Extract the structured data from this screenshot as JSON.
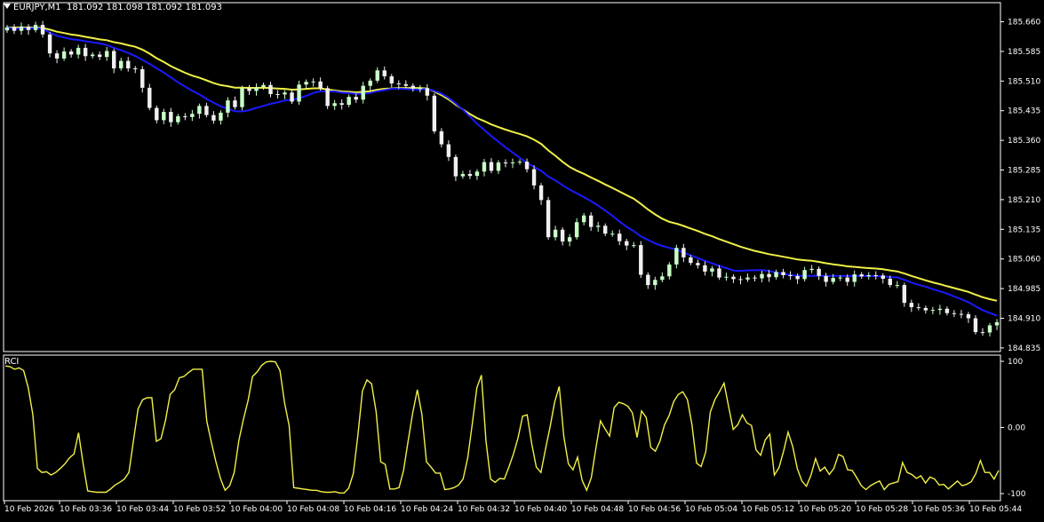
{
  "header": {
    "symbol": "EURJPY,M1",
    "ohlc": "181.092 181.098 181.092 181.093"
  },
  "indicator": {
    "label": "RCI"
  },
  "colors": {
    "background": "#000000",
    "grid": "#ffffff",
    "bull": "#c8ffc8",
    "bear": "#f0f0f0",
    "ma_fast": "#1a1aff",
    "ma_slow": "#f0f048",
    "rci": "#f0f048"
  },
  "chart_data": [
    {
      "type": "candlestick",
      "title": "EURJPY,M1",
      "y_ticks": [
        "185.660",
        "185.585",
        "185.510",
        "185.435",
        "185.360",
        "185.285",
        "185.210",
        "185.135",
        "185.060",
        "184.985",
        "184.910",
        "184.835"
      ],
      "ylim": [
        184.835,
        185.695
      ],
      "x_ticks": [
        "10 Feb 2026",
        "10 Feb 03:36",
        "10 Feb 03:44",
        "10 Feb 03:52",
        "10 Feb 04:00",
        "10 Feb 04:08",
        "10 Feb 04:16",
        "10 Feb 04:24",
        "10 Feb 04:32",
        "10 Feb 04:40",
        "10 Feb 04:48",
        "10 Feb 04:56",
        "10 Feb 05:04",
        "10 Feb 05:12",
        "10 Feb 05:20",
        "10 Feb 05:28",
        "10 Feb 05:36",
        "10 Feb 05:44"
      ],
      "close": [
        185.646,
        185.637,
        185.648,
        185.639,
        185.652,
        185.628,
        185.58,
        185.567,
        185.585,
        185.577,
        185.594,
        185.573,
        185.577,
        185.571,
        185.586,
        185.542,
        185.561,
        185.542,
        185.54,
        185.493,
        185.442,
        185.411,
        185.432,
        185.406,
        185.421,
        185.419,
        185.427,
        185.447,
        185.424,
        185.41,
        185.43,
        185.461,
        185.444,
        185.492,
        185.485,
        185.494,
        185.5,
        185.477,
        185.476,
        185.481,
        185.458,
        185.501,
        185.508,
        185.509,
        185.492,
        185.447,
        185.454,
        185.45,
        185.47,
        185.463,
        185.498,
        185.511,
        185.537,
        185.522,
        185.504,
        185.502,
        185.498,
        185.491,
        185.492,
        185.473,
        185.383,
        185.35,
        185.318,
        185.269,
        185.275,
        185.27,
        185.281,
        185.305,
        185.283,
        185.304,
        185.302,
        185.304,
        185.306,
        185.287,
        185.246,
        185.209,
        185.115,
        185.134,
        185.104,
        185.115,
        185.153,
        185.17,
        185.141,
        185.144,
        185.124,
        185.124,
        185.105,
        185.094,
        185.095,
        185.02,
        184.994,
        185.007,
        185.016,
        185.046,
        185.088,
        185.064,
        185.05,
        185.044,
        185.028,
        185.036,
        185.013,
        185.015,
        185.009,
        185.008,
        185.013,
        185.011,
        185.022,
        185.014,
        185.027,
        185.019,
        185.017,
        185.009,
        185.032,
        185.035,
        185.017,
        185.002,
        185.012,
        185.013,
        185.002,
        185.021,
        185.016,
        185.019,
        185.018,
        185.01,
        184.994,
        184.994,
        184.949,
        184.938,
        184.936,
        184.93,
        184.931,
        184.934,
        184.923,
        184.921,
        184.92,
        184.91,
        184.875,
        184.874,
        184.892,
        184.9
      ]
    },
    {
      "type": "line",
      "title": "RCI",
      "y_ticks": [
        "100",
        "0.00",
        "-100"
      ],
      "ylim": [
        -100,
        100
      ],
      "values": [
        93,
        92,
        88,
        90,
        86,
        60,
        20,
        -62,
        -68,
        -67,
        -72,
        -68,
        -62,
        -55,
        -46,
        -40,
        -8,
        -55,
        -96,
        -97,
        -98,
        -98,
        -98,
        -93,
        -87,
        -83,
        -78,
        -68,
        -19,
        28,
        42,
        45,
        45,
        -21,
        -17,
        11,
        50,
        57,
        75,
        77,
        83,
        88,
        88,
        88,
        10,
        -22,
        -52,
        -77,
        -95,
        -88,
        -68,
        -20,
        12,
        40,
        77,
        84,
        94,
        99,
        100,
        99,
        86,
        37,
        3,
        -91,
        -92,
        -93,
        -94,
        -95,
        -95,
        -97,
        -98,
        -98,
        -97,
        -99,
        -99,
        -92,
        -70,
        -13,
        55,
        72,
        66,
        24,
        -52,
        -56,
        -93,
        -93,
        -91,
        -65,
        -20,
        22,
        57,
        20,
        -52,
        -60,
        -69,
        -69,
        -94,
        -93,
        -91,
        -87,
        -78,
        -46,
        5,
        60,
        79,
        -21,
        -78,
        -83,
        -77,
        -78,
        -60,
        -40,
        -16,
        17,
        19,
        -25,
        -60,
        -68,
        -33,
        1,
        38,
        62,
        -14,
        -55,
        -64,
        -45,
        -80,
        -95,
        -76,
        -32,
        10,
        -2,
        -13,
        30,
        38,
        36,
        32,
        22,
        -15,
        25,
        15,
        -30,
        -36,
        -21,
        4,
        18,
        39,
        50,
        54,
        42,
        4,
        -54,
        -59,
        -37,
        23,
        42,
        54,
        67,
        32,
        -3,
        4,
        19,
        7,
        3,
        -34,
        -42,
        -19,
        -10,
        -72,
        -61,
        -36,
        -7,
        -29,
        -62,
        -81,
        -89,
        -72,
        -47,
        -66,
        -60,
        -71,
        -62,
        -41,
        -44,
        -64,
        -65,
        -76,
        -88,
        -94,
        -88,
        -84,
        -81,
        -94,
        -86,
        -84,
        -82,
        -53,
        -68,
        -71,
        -77,
        -73,
        -84,
        -75,
        -78,
        -87,
        -86,
        -93,
        -87,
        -81,
        -88,
        -86,
        -82,
        -70,
        -50,
        -68,
        -68,
        -78,
        -65
      ]
    }
  ]
}
